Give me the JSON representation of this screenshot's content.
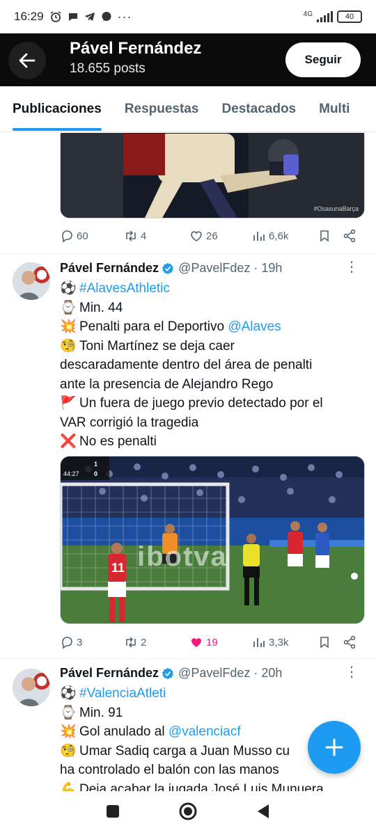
{
  "status_bar": {
    "time": "16:29",
    "network": "4G",
    "battery": "40"
  },
  "header": {
    "name": "Pável Fernández",
    "posts": "18.655 posts",
    "follow_label": "Seguir"
  },
  "tabs": [
    {
      "label": "Publicaciones"
    },
    {
      "label": "Respuestas"
    },
    {
      "label": "Destacados"
    },
    {
      "label": "Multi"
    }
  ],
  "tweet0": {
    "media_watermark": "#OsasunaBarça",
    "actions": {
      "replies": "60",
      "retweets": "4",
      "likes": "26",
      "views": "6,6k"
    }
  },
  "tweet1": {
    "name": "Pável Fernández",
    "handle": "@PavelFdez",
    "time": "· 19h",
    "lines": [
      {
        "emoji": "⚽",
        "text": "",
        "link": "#AlavesAthletic"
      },
      {
        "emoji": "⌚",
        "text": "Min. 44",
        "link": ""
      },
      {
        "emoji": "💥",
        "text": "Penalti para el Deportivo ",
        "link": "@Alaves"
      },
      {
        "emoji": "🧐",
        "text": "Toni Martínez se deja caer",
        "link": ""
      },
      {
        "emoji": "",
        "text": "descaradamente dentro del área de penalti",
        "link": ""
      },
      {
        "emoji": "",
        "text": "ante la presencia de Alejandro Rego",
        "link": ""
      },
      {
        "emoji": "🚩",
        "text": "Un fuera de juego previo detectado por el",
        "link": ""
      },
      {
        "emoji": "",
        "text": "VAR corrigió la tragedia",
        "link": ""
      },
      {
        "emoji": "❌",
        "text": "No es penalti",
        "link": ""
      }
    ],
    "media": {
      "clock": "44:27",
      "score_home": "1",
      "score_away": "0",
      "player_number": "11",
      "banner": "ibotva"
    },
    "actions": {
      "replies": "3",
      "retweets": "2",
      "likes": "19",
      "views": "3,3k"
    }
  },
  "tweet2": {
    "name": "Pável Fernández",
    "handle": "@PavelFdez",
    "time": "· 20h",
    "lines": [
      {
        "emoji": "⚽",
        "text": "",
        "link": "#ValenciaAtleti"
      },
      {
        "emoji": "⌚",
        "text": "Min. 91",
        "link": ""
      },
      {
        "emoji": "💥",
        "text": "Gol anulado al ",
        "link": "@valenciacf"
      },
      {
        "emoji": "🧐",
        "text": "Umar Sadiq carga a Juan Musso cu",
        "link": ""
      },
      {
        "emoji": "",
        "text": "ha controlado el balón con las manos",
        "link": ""
      },
      {
        "emoji": "💪",
        "text": "Deja acabar la jugada José Luis Munuera",
        "link": ""
      }
    ]
  },
  "colors": {
    "accent": "#1d9bf0",
    "like": "#f91880",
    "header_bg": "#0b0b0b"
  },
  "icons": [
    "back-arrow-icon",
    "reply-icon",
    "retweet-icon",
    "heart-icon",
    "views-icon",
    "bookmark-icon",
    "share-icon",
    "verified-icon",
    "more-icon",
    "plus-icon"
  ]
}
